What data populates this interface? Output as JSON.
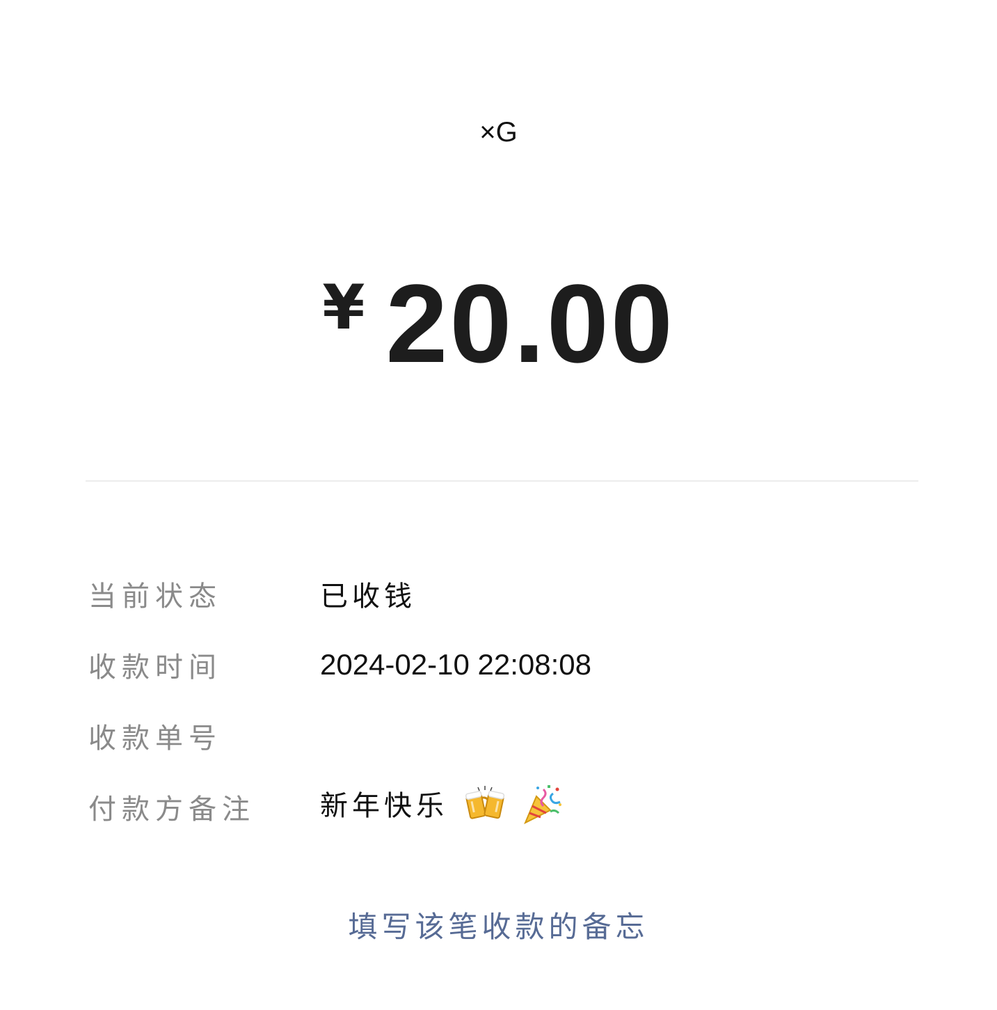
{
  "payer": {
    "name": "×G"
  },
  "amount": {
    "currency_symbol": "¥",
    "value": "20.00"
  },
  "details": {
    "status_label": "当前状态",
    "status_value": "已收钱",
    "time_label": "收款时间",
    "time_value": "2024-02-10 22:08:08",
    "order_label": "收款单号",
    "order_value": "",
    "remark_label": "付款方备注",
    "remark_value": "新年快乐",
    "remark_emojis": [
      "beers-icon",
      "party-popper-icon"
    ]
  },
  "actions": {
    "add_remark_label": "填写该笔收款的备忘"
  },
  "colors": {
    "label": "#8a8a8a",
    "value": "#111111",
    "link": "#576b95",
    "divider": "#ececec"
  }
}
